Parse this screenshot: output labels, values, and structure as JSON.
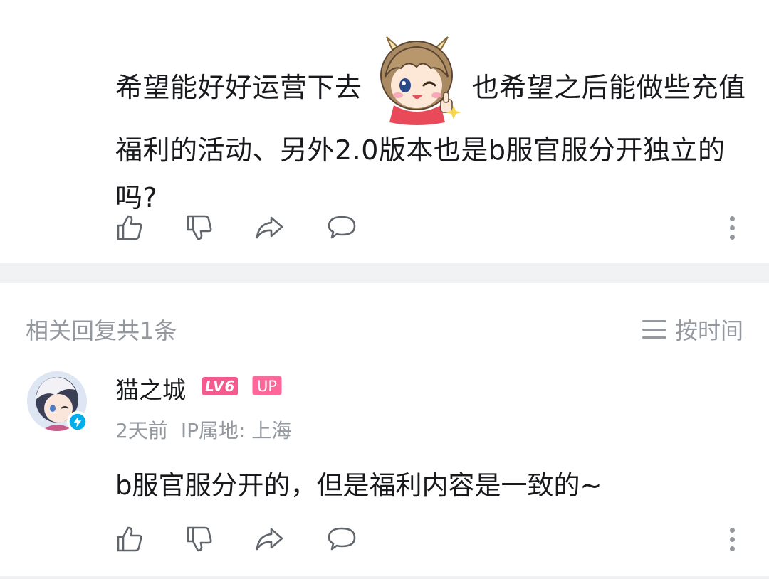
{
  "comment": {
    "text_part1": "希望能好好运营下去",
    "sticker": "cat-girl-wink-thumbs-up-sticker",
    "text_part2": "也希望之后能做些充值福利的活动、另外2.0版本也是b服官服分开独立的吗?"
  },
  "action_icons": [
    "like-icon",
    "dislike-icon",
    "share-icon",
    "reply-icon",
    "more-icon"
  ],
  "replies_section": {
    "title": "相关回复共1条",
    "sort_label": "按时间"
  },
  "reply": {
    "username": "猫之城",
    "level_badge": "LV6",
    "up_badge": "UP",
    "time": "2天前",
    "ip_location": "IP属地: 上海",
    "text": "b服官服分开的，但是福利内容是一致的~"
  },
  "colors": {
    "text": "#18191c",
    "muted": "#9499a0",
    "divider": "#f1f2f3",
    "level_badge": "#f45a8d",
    "up_badge": "#ff6699",
    "verify": "#00aeec"
  }
}
